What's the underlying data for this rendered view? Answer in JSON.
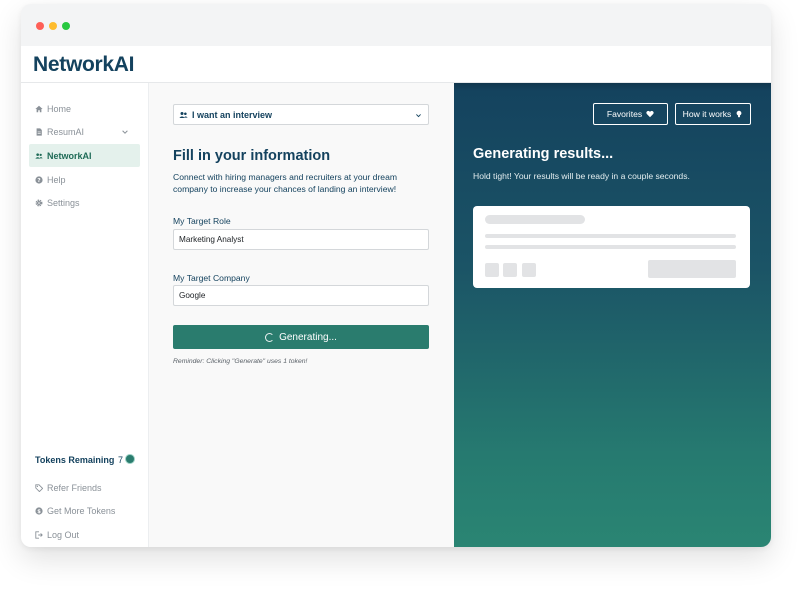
{
  "app": {
    "logo": "NetworkAI"
  },
  "sidebar": {
    "items": [
      {
        "label": "Home",
        "icon": "home-icon"
      },
      {
        "label": "ResumAI",
        "icon": "document-icon"
      },
      {
        "label": "NetworkAI",
        "icon": "users-icon",
        "active": true
      },
      {
        "label": "Help",
        "icon": "help-icon"
      },
      {
        "label": "Settings",
        "icon": "gear-icon"
      }
    ],
    "tokens_label": "Tokens Remaining",
    "tokens_count": "7",
    "bottom_items": [
      {
        "label": "Refer Friends",
        "icon": "tag-icon"
      },
      {
        "label": "Get More Tokens",
        "icon": "coin-icon"
      },
      {
        "label": "Log Out",
        "icon": "logout-icon"
      }
    ]
  },
  "form": {
    "mode_select": "I want an interview",
    "title": "Fill in your information",
    "description": "Connect with hiring managers and recruiters at your dream company to increase your chances of landing an interview!",
    "role_label": "My Target Role",
    "role_value": "Marketing Analyst",
    "company_label": "My Target Company",
    "company_value": "Google",
    "generate_label": "Generating...",
    "reminder": "Reminder: Clicking \"Generate\" uses 1 token!"
  },
  "results": {
    "favorites_label": "Favorites",
    "how_label": "How it works",
    "title": "Generating results...",
    "subtitle": "Hold tight! Your results will be ready in a couple seconds."
  },
  "colors": {
    "primary": "#14425e",
    "accent": "#2a7c6e",
    "active_bg": "#e4f1ec"
  }
}
